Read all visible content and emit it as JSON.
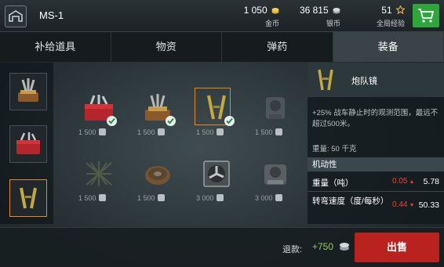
{
  "topbar": {
    "tank_name": "MS-1",
    "gold": {
      "value": "1 050",
      "label": "金币"
    },
    "silver": {
      "value": "36 815",
      "label": "银币"
    },
    "xp": {
      "value": "51",
      "label": "全局经验"
    }
  },
  "tabs": [
    {
      "label": "补给道具",
      "active": false
    },
    {
      "label": "物资",
      "active": false
    },
    {
      "label": "弹药",
      "active": false
    },
    {
      "label": "装备",
      "active": true
    }
  ],
  "items": [
    {
      "price": "1 500",
      "installed": true
    },
    {
      "price": "1 500",
      "installed": true
    },
    {
      "price": "1 500",
      "installed": true
    },
    {
      "price": "1 500",
      "installed": false
    },
    {
      "price": "1 500",
      "installed": false
    },
    {
      "price": "1 500",
      "installed": false
    },
    {
      "price": "3 000",
      "installed": false
    },
    {
      "price": "3 000",
      "installed": false
    }
  ],
  "panel": {
    "name": "炮队镜",
    "description": "+25% 战车静止时的观测范围，最远不超过500米。",
    "weight": "重量: 50 千克",
    "section": "机动性",
    "stats": [
      {
        "label": "重量（吨）",
        "delta": "0.05",
        "value": "5.78"
      },
      {
        "label": "转弯速度（度/每秒）",
        "delta": "0.44",
        "value": "50.33"
      }
    ]
  },
  "bottom": {
    "refund_label": "退款:",
    "refund_value": "+750",
    "sell_label": "出售"
  },
  "colors": {
    "accent_orange": "#e0892b",
    "sell_red": "#b9221f",
    "cart_green": "#2fa63c",
    "negative_red": "#e6403c",
    "refund_green": "#8ed24d"
  }
}
